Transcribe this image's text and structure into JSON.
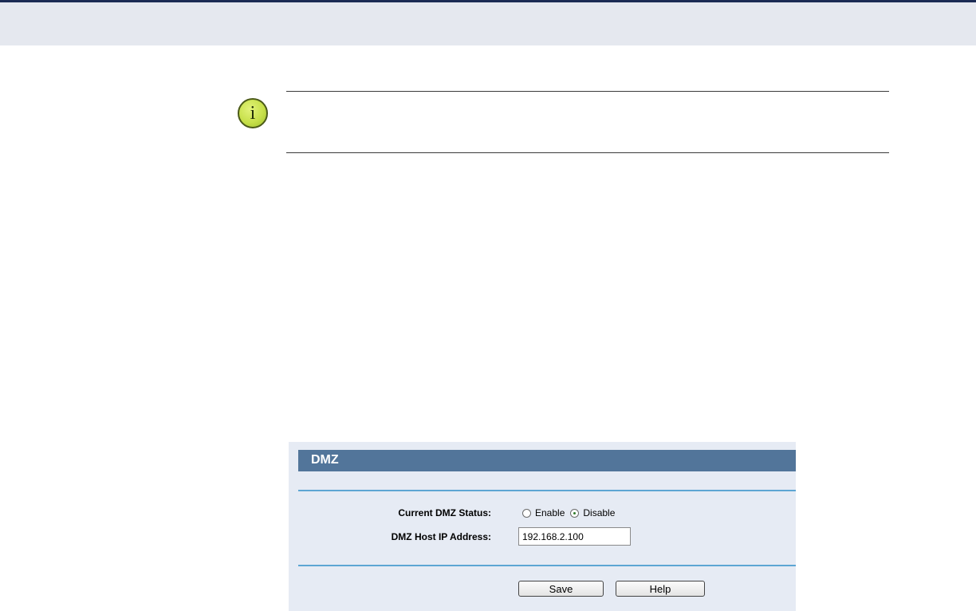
{
  "colors": {
    "top_rule": "#1b2b54",
    "header_band": "#e5e8ef",
    "panel_bg": "#e6ebf4",
    "panel_header": "#52759a",
    "panel_rule": "#5da6d3",
    "note_icon": "#c7e04a"
  },
  "note": {
    "icon": "info-icon",
    "glyph": "i"
  },
  "panel": {
    "title": "DMZ",
    "status": {
      "label": "Current DMZ Status:",
      "options": [
        {
          "label": "Enable",
          "checked": false
        },
        {
          "label": "Disable",
          "checked": true
        }
      ]
    },
    "host_ip": {
      "label": "DMZ Host IP Address:",
      "value": "192.168.2.100"
    },
    "buttons": {
      "save": "Save",
      "help": "Help"
    }
  }
}
